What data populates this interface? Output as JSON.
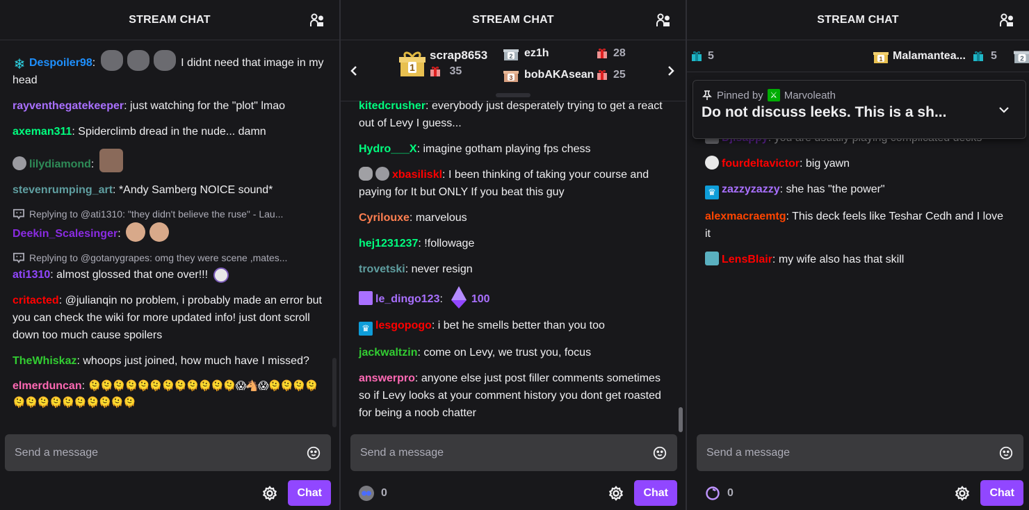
{
  "colors": {
    "background": "#18181b",
    "input_bg": "#3a3a3d",
    "accent": "#9147ff",
    "text": "#efeff1",
    "muted": "#adadb8"
  },
  "panels": [
    {
      "header": {
        "title": "STREAM CHAT"
      },
      "messages": [
        {
          "badges": [
            "snowflake-badge"
          ],
          "user": "Despoiler98",
          "color": "#1e90ff",
          "emotes_before": [
            "cat-emote",
            "cat-emote",
            "cat-emote"
          ],
          "text": "I didnt need that image in my head"
        },
        {
          "user": "rayventhegatekeeper",
          "color": "#a970ff",
          "text": "just watching for the \"plot\" lmao"
        },
        {
          "user": "axeman311",
          "color": "#00ff7f",
          "text": "Spiderclimb dread in the nude... damn"
        },
        {
          "badges": [
            "sub-gifter-badge"
          ],
          "user": "lilydiamond",
          "color": "#2e8b57",
          "emotes_before": [
            "facepalm-emote"
          ],
          "text": ""
        },
        {
          "user": "stevenrumping_art",
          "color": "#5f9ea0",
          "text": "*Andy Samberg NOICE sound*"
        },
        {
          "reply_to": "Replying to @ati1310: \"they didn't believe the ruse\" - Lau...",
          "user": "Deekin_Scalesinger",
          "color": "#8a2be2",
          "emotes_before": [
            "laugh-emote",
            "laugh-emote"
          ],
          "text": ""
        },
        {
          "reply_to": "Replying to @gotanygrapes: omg they were scene ,mates...",
          "user": "ati1310",
          "color": "#9146ff",
          "text": "almost glossed that one over!!!",
          "emotes_after": [
            "ghost-emote"
          ]
        },
        {
          "user": "critacted",
          "color": "#ff0000",
          "text": "@julianqin no problem, i probably made an error but you can check the wiki for more updated info! just dont scroll down too much cause spoilers"
        },
        {
          "user": "TheWhiskaz",
          "color": "#32cd32",
          "text": "whoops just joined, how much have I missed?"
        },
        {
          "user": "elmerduncan",
          "color": "#ff69b4",
          "text": "🫠🫠🫠🫠🫠🫠🫠🫠🫠🫠🫠🫠😱🐴😱🫠🫠🫠🫠🫠🫠🫠🫠🫠🫠🫠🫠🫠🫠"
        }
      ],
      "input": {
        "placeholder": "Send a message"
      },
      "footer": {
        "chat_button": "Chat"
      }
    },
    {
      "header": {
        "title": "STREAM CHAT"
      },
      "leaderboard": {
        "entries": [
          {
            "rank": "1",
            "user": "scrap8653",
            "gifts": "35"
          },
          {
            "rank": "2",
            "user": "ez1h",
            "gifts": "28"
          },
          {
            "rank": "3",
            "user": "bobAKAsean",
            "gifts": "25"
          }
        ]
      },
      "messages": [
        {
          "user": "kitedcrusher",
          "color": "#00ff7f",
          "text": "everybody just desperately trying to get a react out of Levy I guess..."
        },
        {
          "user": "Hydro___X",
          "color": "#00ff7f",
          "text": "imagine gotham playing fps chess"
        },
        {
          "badges": [
            "crown-statue-badge",
            "sub-gifter-badge"
          ],
          "user": "xbasiliskl",
          "color": "#ff0000",
          "text": "I been thinking of taking your course and paying for It but ONLY If you beat this guy"
        },
        {
          "user": "Cyrilouxe",
          "color": "#ff7f50",
          "text": "marvelous"
        },
        {
          "user": "hej1231237",
          "color": "#00ff7f",
          "text": "!followage"
        },
        {
          "user": "trovetski",
          "color": "#5f9ea0",
          "text": "never resign"
        },
        {
          "badges": [
            "bits-badge"
          ],
          "user": "le_dingo123",
          "color": "#a970ff",
          "cheer": "100",
          "text": ""
        },
        {
          "badges": [
            "prime-badge"
          ],
          "user": "lesgopogo",
          "color": "#ff0000",
          "text": "i bet he smells better than you too"
        },
        {
          "user": "jackwaltzin",
          "color": "#32cd32",
          "text": "come on Levy, we trust you, focus"
        },
        {
          "user": "answerpro",
          "color": "#ff69b4",
          "text": "anyone else just post filler comments sometimes so if Levy looks at your comment history you dont get roasted for being a noob chatter"
        }
      ],
      "input": {
        "placeholder": "Send a message"
      },
      "footer": {
        "points": "0",
        "chat_button": "Chat"
      }
    },
    {
      "header": {
        "title": "STREAM CHAT"
      },
      "leaderboard": {
        "prev_count": "5",
        "entries": [
          {
            "rank": "1",
            "user": "Malamantea...",
            "gifts": "5"
          },
          {
            "rank": "2",
            "user": "",
            "gifts": ""
          }
        ]
      },
      "pinned": {
        "label": "Pinned by",
        "by": "Marvoleath",
        "text": "Do not discuss leeks. This is a sh..."
      },
      "messages": [
        {
          "badges": [
            "gray-badge"
          ],
          "user": "Djisappy",
          "color": "#8a2be2",
          "text": "you are usually playing complicated decks"
        },
        {
          "badges": [
            "bandage-badge"
          ],
          "user": "fourdeltavictor",
          "color": "#ff0000",
          "text": "big yawn"
        },
        {
          "badges": [
            "prime-badge"
          ],
          "user": "zazzyzazzy",
          "color": "#a970ff",
          "text": "she has \"the power\""
        },
        {
          "user": "alexmacraemtg",
          "color": "#ff4500",
          "text": "This deck feels like Teshar Cedh and I love it"
        },
        {
          "badges": [
            "artist-badge"
          ],
          "user": "LensBlair",
          "color": "#ff0000",
          "text": "my wife also has that skill"
        }
      ],
      "input": {
        "placeholder": "Send a message"
      },
      "footer": {
        "points": "0",
        "chat_button": "Chat"
      }
    }
  ]
}
